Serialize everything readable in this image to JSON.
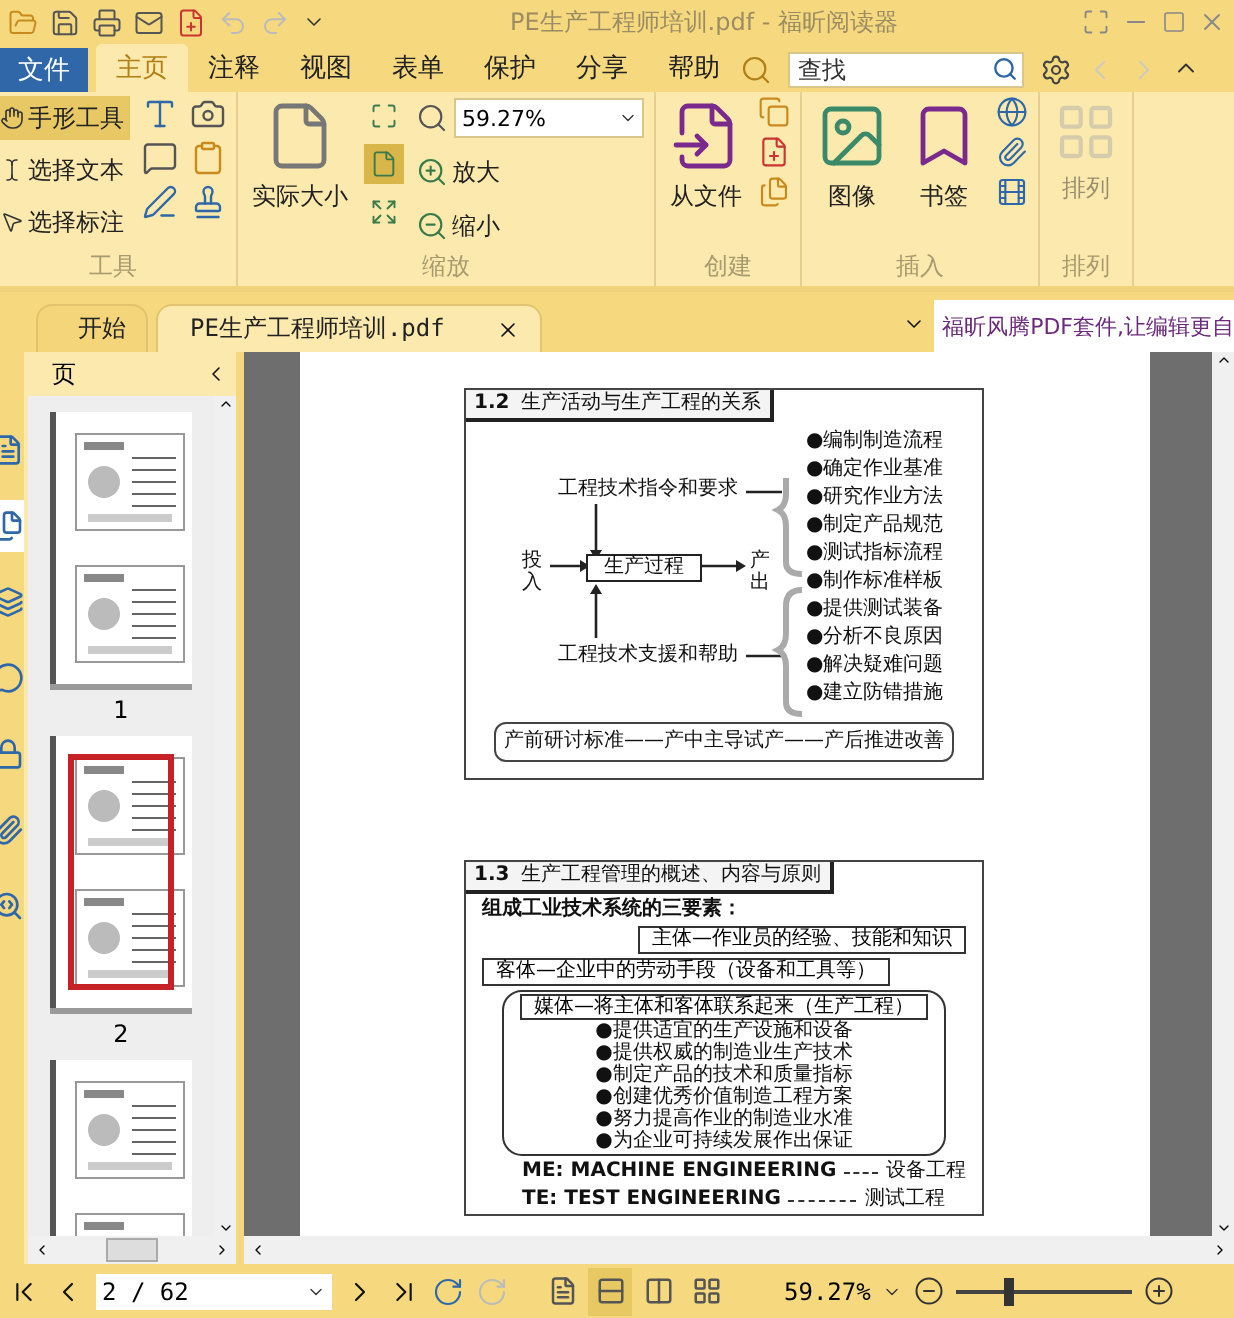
{
  "window": {
    "title": "PE生产工程师培训.pdf - 福昕阅读器"
  },
  "file_menu": "文件",
  "tabs": [
    {
      "label": "主页",
      "selected": true
    },
    {
      "label": "注释",
      "selected": false
    },
    {
      "label": "视图",
      "selected": false
    },
    {
      "label": "表单",
      "selected": false
    },
    {
      "label": "保护",
      "selected": false
    },
    {
      "label": "分享",
      "selected": false
    },
    {
      "label": "帮助",
      "selected": false
    }
  ],
  "search": {
    "placeholder": "查找"
  },
  "ribbon": {
    "tools": {
      "title": "工具",
      "items": [
        {
          "label": "手形工具",
          "selected": true
        },
        {
          "label": "选择文本",
          "selected": false
        },
        {
          "label": "选择标注",
          "selected": false
        }
      ]
    },
    "zoom": {
      "title": "缩放",
      "actual_size": "实际大小",
      "value": "59.27%",
      "zoom_in": "放大",
      "zoom_out": "缩小",
      "fit_modes": [
        {
          "selected": false
        },
        {
          "selected": true
        },
        {
          "selected": false
        }
      ]
    },
    "create": {
      "title": "创建",
      "from_file": "从文件"
    },
    "insert": {
      "title": "插入",
      "image": "图像",
      "bookmark": "书签"
    },
    "arrange": {
      "title": "排列",
      "button": "排列",
      "disabled": true
    }
  },
  "doc_tabs": [
    {
      "label": "开始",
      "selected": false,
      "closable": false
    },
    {
      "label": "PE生产工程师培训.pdf",
      "selected": true,
      "closable": true
    }
  ],
  "ad_text": "福昕风腾PDF套件,让编辑更自",
  "sidebar": {
    "title": "页",
    "panels": [
      {
        "selected": false
      },
      {
        "selected": true
      },
      {
        "selected": false
      },
      {
        "selected": false
      },
      {
        "selected": false
      },
      {
        "selected": false
      },
      {
        "selected": false
      }
    ],
    "thumbnails": [
      {
        "label": "1",
        "selected": false
      },
      {
        "label": "2",
        "selected": true
      },
      {
        "selected": false
      }
    ]
  },
  "document": {
    "slides": [
      {
        "kind": "relation",
        "number": "1.2",
        "title": "生产活动与生产工程的关系",
        "upper_label": "工程技术指令和要求",
        "lower_label": "工程技术支援和帮助",
        "input": "投入",
        "process": "生产过程",
        "output": "产出",
        "items": [
          "●编制制造流程",
          "●确定作业基准",
          "●研究作业方法",
          "●制定产品规范",
          "●测试指标流程",
          "●制作标准样板",
          "●提供测试装备",
          "●分析不良原因",
          "●解决疑难问题",
          "●建立防错措施"
        ],
        "footer": "产前研讨标准——产中主导试产——产后推进改善"
      },
      {
        "kind": "overview",
        "number": "1.3",
        "title": "生产工程管理的概述、内容与原则",
        "intro": "组成工业技术系统的三要素：",
        "subject": "主体—作业员的经验、技能和知识",
        "object": "客体—企业中的劳动手段（设备和工具等）",
        "medium": "媒体—将主体和客体联系起来（生产工程）",
        "bullets": [
          "●提供适宜的生产设施和设备",
          "●提供权威的制造业生产技术",
          "●制定产品的技术和质量指标",
          "●创建优秀价值制造工程方案",
          "●努力提高作业的制造业水准",
          "●为企业可持续发展作出保证"
        ],
        "terms": [
          {
            "abbr": "ME: MACHINE ENGINEERING",
            "meaning": "设备工程"
          },
          {
            "abbr": "TE: TEST ENGINEERING",
            "meaning": "测试工程"
          }
        ]
      }
    ]
  },
  "status_bar": {
    "page": "2 / 62",
    "zoom": "59.27%",
    "zoom_slider": {
      "level": 0.27
    },
    "views": [
      {
        "selected": false
      },
      {
        "selected": true
      },
      {
        "selected": false
      },
      {
        "selected": false
      }
    ]
  }
}
